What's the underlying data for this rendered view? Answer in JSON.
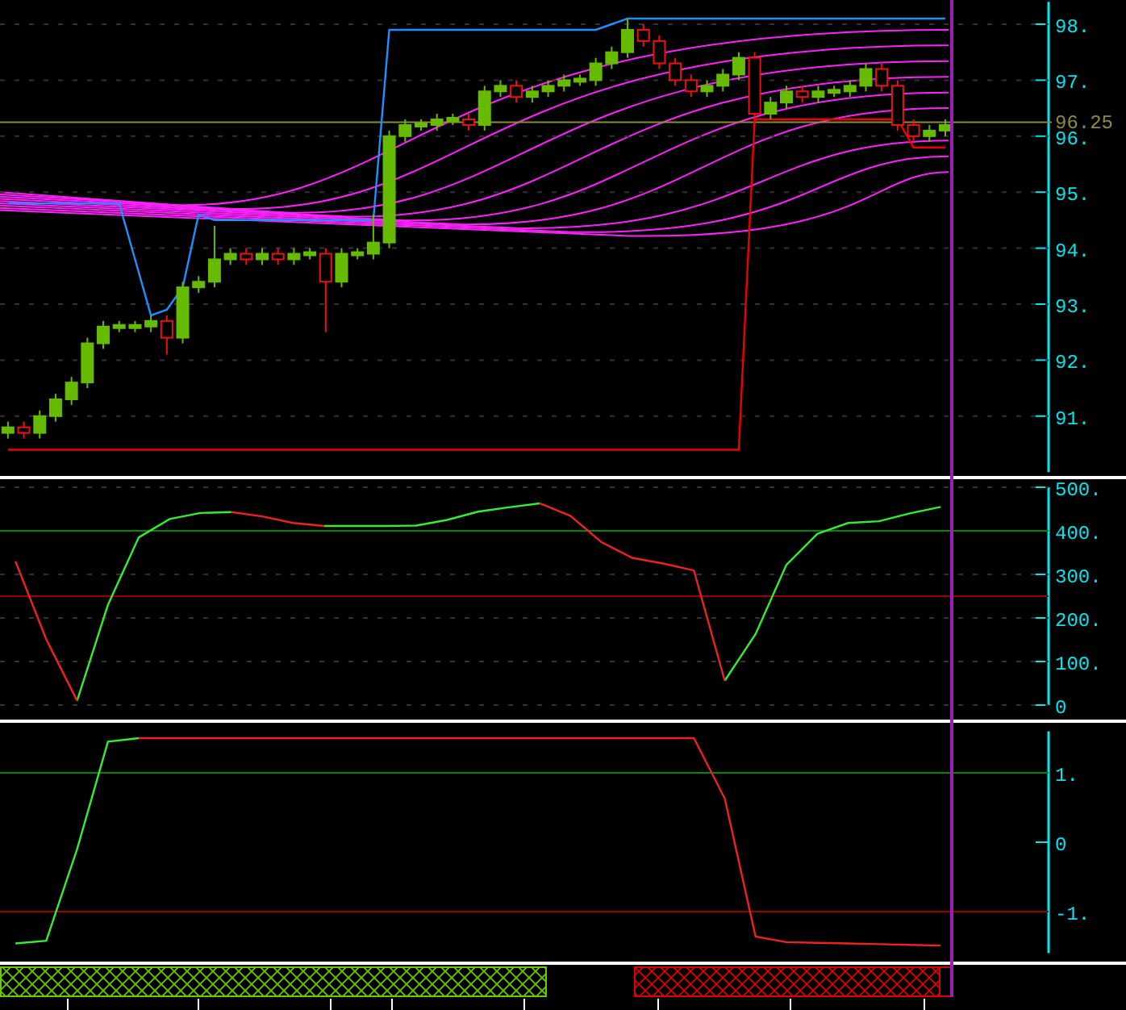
{
  "price_panel": {
    "chart_data": {
      "type": "candlestick",
      "grid": true,
      "ylim": [
        90,
        98.4
      ],
      "yticks": [
        {
          "value": 98,
          "label": "98."
        },
        {
          "value": 97,
          "label": "97."
        },
        {
          "value": 96,
          "label": "96."
        },
        {
          "value": 95,
          "label": "95."
        },
        {
          "value": 94,
          "label": "94."
        },
        {
          "value": 93,
          "label": "93."
        },
        {
          "value": 92,
          "label": "92."
        },
        {
          "value": 91,
          "label": "91."
        }
      ],
      "ohlc": [
        [
          90.7,
          90.9,
          90.6,
          90.8
        ],
        [
          90.8,
          90.9,
          90.6,
          90.7
        ],
        [
          90.7,
          91.1,
          90.6,
          91.0
        ],
        [
          91.0,
          91.4,
          90.9,
          91.3
        ],
        [
          91.3,
          91.7,
          91.2,
          91.6
        ],
        [
          91.6,
          92.4,
          91.5,
          92.3
        ],
        [
          92.3,
          92.7,
          92.2,
          92.6
        ],
        [
          92.6,
          92.7,
          92.5,
          92.6
        ],
        [
          92.6,
          92.7,
          92.5,
          92.6
        ],
        [
          92.6,
          92.8,
          92.5,
          92.7
        ],
        [
          92.7,
          92.8,
          92.1,
          92.4
        ],
        [
          92.4,
          93.4,
          92.3,
          93.3
        ],
        [
          93.3,
          93.5,
          93.2,
          93.4
        ],
        [
          93.4,
          94.4,
          93.3,
          93.8
        ],
        [
          93.8,
          94.0,
          93.7,
          93.9
        ],
        [
          93.9,
          94.0,
          93.7,
          93.8
        ],
        [
          93.8,
          94.0,
          93.7,
          93.9
        ],
        [
          93.9,
          94.0,
          93.7,
          93.8
        ],
        [
          93.8,
          94.0,
          93.7,
          93.9
        ],
        [
          93.9,
          94.0,
          93.8,
          93.9
        ],
        [
          93.9,
          94.0,
          92.5,
          93.4
        ],
        [
          93.4,
          94.0,
          93.3,
          93.9
        ],
        [
          93.9,
          94.0,
          93.8,
          93.9
        ],
        [
          93.9,
          94.6,
          93.8,
          94.1
        ],
        [
          94.1,
          96.1,
          94.0,
          96.0
        ],
        [
          96.0,
          96.3,
          95.9,
          96.2
        ],
        [
          96.2,
          96.3,
          96.1,
          96.2
        ],
        [
          96.2,
          96.4,
          96.1,
          96.3
        ],
        [
          96.3,
          96.4,
          96.2,
          96.3
        ],
        [
          96.3,
          96.4,
          96.1,
          96.2
        ],
        [
          96.2,
          96.9,
          96.1,
          96.8
        ],
        [
          96.8,
          97.0,
          96.7,
          96.9
        ],
        [
          96.9,
          97.0,
          96.6,
          96.7
        ],
        [
          96.7,
          96.9,
          96.6,
          96.8
        ],
        [
          96.8,
          97.0,
          96.7,
          96.9
        ],
        [
          96.9,
          97.1,
          96.8,
          97.0
        ],
        [
          97.0,
          97.1,
          96.9,
          97.0
        ],
        [
          97.0,
          97.4,
          96.9,
          97.3
        ],
        [
          97.3,
          97.6,
          97.2,
          97.5
        ],
        [
          97.5,
          98.1,
          97.4,
          97.9
        ],
        [
          97.9,
          98.0,
          97.6,
          97.7
        ],
        [
          97.7,
          97.8,
          97.2,
          97.3
        ],
        [
          97.3,
          97.4,
          96.9,
          97.0
        ],
        [
          97.0,
          97.1,
          96.7,
          96.8
        ],
        [
          96.8,
          97.0,
          96.7,
          96.9
        ],
        [
          96.9,
          97.2,
          96.8,
          97.1
        ],
        [
          97.1,
          97.5,
          97.0,
          97.4
        ],
        [
          97.4,
          97.5,
          96.3,
          96.4
        ],
        [
          96.4,
          96.7,
          96.3,
          96.6
        ],
        [
          96.6,
          96.9,
          96.5,
          96.8
        ],
        [
          96.8,
          96.9,
          96.6,
          96.7
        ],
        [
          96.7,
          96.9,
          96.6,
          96.8
        ],
        [
          96.8,
          96.9,
          96.7,
          96.8
        ],
        [
          96.8,
          97.0,
          96.7,
          96.9
        ],
        [
          96.9,
          97.3,
          96.8,
          97.2
        ],
        [
          97.2,
          97.3,
          96.8,
          96.9
        ],
        [
          96.9,
          97.0,
          96.1,
          96.2
        ],
        [
          96.2,
          96.3,
          95.9,
          96.0
        ],
        [
          96.0,
          96.2,
          95.9,
          96.1
        ],
        [
          96.1,
          96.3,
          96.0,
          96.2
        ],
        null,
        null,
        null,
        null,
        null,
        null
      ],
      "series": [
        {
          "type": "line",
          "color": "#1e90ff",
          "values": [
            94.8,
            94.8,
            94.8,
            94.8,
            94.8,
            94.8,
            94.8,
            94.8,
            93.8,
            92.8,
            92.9,
            93.3,
            94.6,
            94.5,
            94.5,
            94.5,
            94.5,
            94.5,
            94.5,
            94.5,
            94.5,
            94.5,
            94.5,
            94.5,
            97.9,
            97.9,
            97.9,
            97.9,
            97.9,
            97.9,
            97.9,
            97.9,
            97.9,
            97.9,
            97.9,
            97.9,
            97.9,
            97.9,
            98.0,
            98.1,
            98.1,
            98.1,
            98.1,
            98.1,
            98.1,
            98.1,
            98.1,
            98.1,
            98.1,
            98.1,
            98.1,
            98.1,
            98.1,
            98.1,
            98.1,
            98.1,
            98.1,
            98.1,
            98.1,
            98.1,
            null,
            null,
            null,
            null,
            null,
            null
          ]
        },
        {
          "type": "line",
          "color": "#ee0000",
          "values": [
            90.4,
            90.4,
            90.4,
            90.4,
            90.4,
            90.4,
            90.4,
            90.4,
            90.4,
            90.4,
            90.4,
            90.4,
            90.4,
            90.4,
            90.4,
            90.4,
            90.4,
            90.4,
            90.4,
            90.4,
            90.4,
            90.4,
            90.4,
            90.4,
            90.4,
            90.4,
            90.4,
            90.4,
            90.4,
            90.4,
            90.4,
            90.4,
            90.4,
            90.4,
            90.4,
            90.4,
            90.4,
            90.4,
            90.4,
            90.4,
            90.4,
            90.4,
            90.4,
            90.4,
            90.4,
            90.4,
            90.4,
            96.3,
            96.3,
            96.3,
            96.3,
            96.3,
            96.3,
            96.3,
            96.3,
            96.3,
            96.3,
            95.8,
            95.8,
            95.8,
            null,
            null,
            null,
            null,
            null,
            null
          ]
        }
      ],
      "ref_lines": [
        {
          "axis": "y",
          "value": 96.25,
          "label": "96.25",
          "color": "#8c8c3c"
        }
      ]
    }
  },
  "oscillator_panel": {
    "chart_data": {
      "type": "line",
      "grid": true,
      "ylim": [
        0,
        500
      ],
      "yticks": [
        {
          "value": 500,
          "label": "500."
        },
        {
          "value": 400,
          "label": "400."
        },
        {
          "value": 300,
          "label": "300."
        },
        {
          "value": 200,
          "label": "200."
        },
        {
          "value": 100,
          "label": "100."
        },
        {
          "value": 0,
          "label": "0"
        }
      ],
      "series": [
        {
          "color": "#33ee33",
          "values": [
            null,
            null,
            10,
            230,
            385,
            427,
            441,
            443,
            null,
            null,
            411,
            411,
            411,
            412,
            425,
            444,
            454,
            463,
            null,
            null,
            null,
            null,
            null,
            56,
            163,
            322,
            393,
            418,
            422,
            440,
            455,
            null,
            null,
            null
          ]
        },
        {
          "color": "#ee2222",
          "values": [
            330,
            151,
            10,
            null,
            null,
            null,
            null,
            443,
            433,
            418,
            411,
            null,
            null,
            null,
            null,
            null,
            null,
            463,
            434,
            374,
            338,
            325,
            309,
            56,
            null,
            null,
            null,
            null,
            null,
            null,
            null,
            null,
            null,
            null
          ]
        }
      ],
      "ref_lines": [
        {
          "axis": "y",
          "value": 400,
          "color": "#008800"
        },
        {
          "axis": "y",
          "value": 250,
          "color": "#990000"
        }
      ]
    }
  },
  "trend_panel": {
    "chart_data": {
      "type": "line",
      "ylim": [
        -1.6,
        1.6
      ],
      "yticks": [
        {
          "value": 1,
          "label": "1."
        },
        {
          "value": 0,
          "label": "0"
        },
        {
          "value": -1,
          "label": "-1."
        }
      ],
      "series": [
        {
          "color": "#33ee33",
          "values": [
            -1.46,
            -1.42,
            -0.1,
            1.45,
            1.5,
            null,
            null,
            null,
            null,
            null,
            null,
            null,
            null,
            null,
            null,
            null,
            null,
            null,
            null,
            null,
            null,
            null,
            null,
            null,
            null,
            null,
            null,
            null,
            null,
            null,
            null,
            null,
            null,
            null
          ]
        },
        {
          "color": "#ee2222",
          "values": [
            null,
            null,
            null,
            null,
            1.5,
            1.5,
            1.5,
            1.5,
            1.5,
            1.5,
            1.5,
            1.5,
            1.5,
            1.5,
            1.5,
            1.5,
            1.5,
            1.5,
            1.5,
            1.5,
            1.5,
            1.5,
            1.5,
            0.63,
            -1.36,
            -1.44,
            -1.45,
            -1.46,
            -1.47,
            -1.48,
            -1.49,
            null,
            null,
            null
          ]
        }
      ],
      "ref_lines": [
        {
          "axis": "y",
          "value": 1,
          "color": "#008800"
        },
        {
          "axis": "y",
          "value": -1,
          "color": "#990000"
        }
      ]
    }
  },
  "signal_bars": [
    {
      "color": "#66cc00"
    },
    {
      "color": "#dd0000"
    }
  ]
}
